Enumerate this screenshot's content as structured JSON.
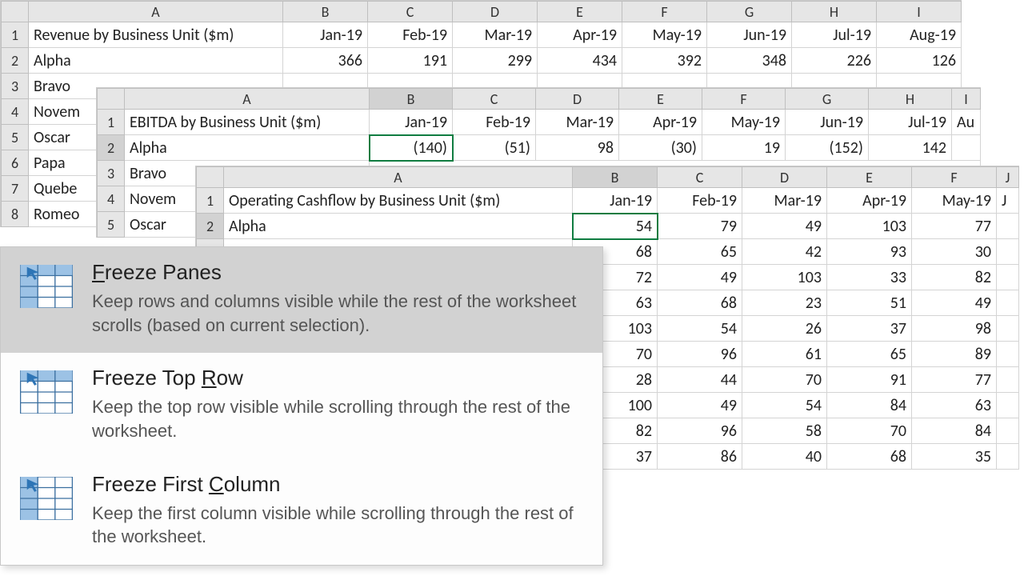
{
  "columns": [
    "A",
    "B",
    "C",
    "D",
    "E",
    "F",
    "G",
    "H",
    "I",
    "J"
  ],
  "sheet1": {
    "title": "Revenue by Business Unit ($m)",
    "colA_w": 318,
    "months": [
      "Jan-19",
      "Feb-19",
      "Mar-19",
      "Apr-19",
      "May-19",
      "Jun-19",
      "Jul-19",
      "Aug-19"
    ],
    "rows": [
      {
        "label": "Alpha",
        "vals": [
          "366",
          "191",
          "299",
          "434",
          "392",
          "348",
          "226",
          "126"
        ]
      },
      {
        "label": "Bravo",
        "vals": [
          "",
          "",
          "",
          "",
          "",
          "",
          "",
          ""
        ]
      },
      {
        "label": "Novem",
        "vals": [
          "",
          "",
          "",
          "",
          "",
          "",
          "",
          ""
        ]
      },
      {
        "label": "Oscar",
        "vals": [
          "",
          "",
          "",
          "",
          "",
          "",
          "",
          ""
        ]
      },
      {
        "label": "Papa",
        "vals": [
          "",
          "",
          "",
          "",
          "",
          "",
          "",
          ""
        ]
      },
      {
        "label": "Quebe",
        "vals": [
          "",
          "",
          "",
          "",
          "",
          "",
          "",
          ""
        ]
      },
      {
        "label": "Romeo",
        "vals": [
          "",
          "",
          "",
          "",
          "",
          "",
          "",
          ""
        ]
      }
    ]
  },
  "sheet2": {
    "title": "EBITDA by Business Unit ($m)",
    "colA_w": 306,
    "months": [
      "Jan-19",
      "Feb-19",
      "Mar-19",
      "Apr-19",
      "May-19",
      "Jun-19",
      "Jul-19",
      "Au"
    ],
    "alpha": [
      "(140)",
      "(51)",
      "98",
      "(30)",
      "19",
      "(152)",
      "142",
      ""
    ],
    "rows_below": [
      "Bravo",
      "Novem",
      "Oscar"
    ]
  },
  "sheet3": {
    "title": "Operating Cashflow by Business Unit ($m)",
    "colA_w": 436,
    "months": [
      "Jan-19",
      "Feb-19",
      "Mar-19",
      "Apr-19",
      "May-19",
      "J"
    ],
    "grid": [
      [
        "Alpha",
        "54",
        "79",
        "49",
        "103",
        "77"
      ],
      [
        "",
        "68",
        "65",
        "42",
        "93",
        "30"
      ],
      [
        "",
        "72",
        "49",
        "103",
        "33",
        "82"
      ],
      [
        "",
        "63",
        "68",
        "23",
        "51",
        "49"
      ],
      [
        "",
        "103",
        "54",
        "26",
        "37",
        "98"
      ],
      [
        "",
        "70",
        "96",
        "61",
        "65",
        "89"
      ],
      [
        "",
        "28",
        "44",
        "70",
        "91",
        "77"
      ],
      [
        "",
        "100",
        "49",
        "54",
        "84",
        "63"
      ],
      [
        "",
        "82",
        "96",
        "58",
        "70",
        "84"
      ],
      [
        "",
        "37",
        "86",
        "40",
        "68",
        "35"
      ]
    ]
  },
  "menu": {
    "items": [
      {
        "t1": "F",
        "t2": "reeze Panes",
        "desc": "Keep rows and columns visible while the rest of the worksheet scrolls (based on current selection)."
      },
      {
        "t1": "Freeze Top ",
        "t2": "R",
        "t3": "ow",
        "desc": "Keep the top row visible while scrolling through the rest of the worksheet."
      },
      {
        "t1": "Freeze First ",
        "t2": "C",
        "t3": "olumn",
        "desc": "Keep the first column visible while scrolling through the rest of the worksheet."
      }
    ]
  }
}
